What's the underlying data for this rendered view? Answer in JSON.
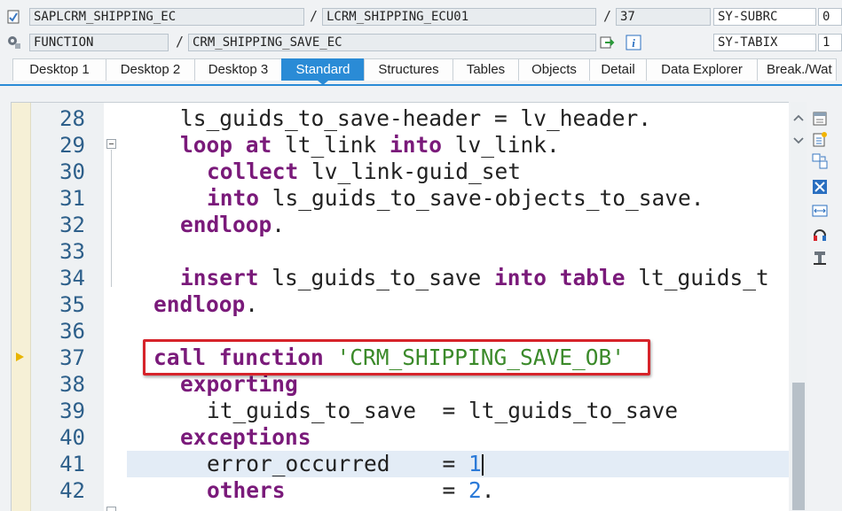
{
  "header": {
    "program": "SAPLCRM_SHIPPING_EC",
    "include": "LCRM_SHIPPING_ECU01",
    "line_no": "37",
    "sysvar1_name": "SY-SUBRC",
    "sysvar1_value": "0",
    "event_type": "FUNCTION",
    "event_name": "CRM_SHIPPING_SAVE_EC",
    "sysvar2_name": "SY-TABIX",
    "sysvar2_value": "1",
    "separator": "/"
  },
  "tabs": [
    "Desktop 1",
    "Desktop 2",
    "Desktop 3",
    "Standard",
    "Structures",
    "Tables",
    "Objects",
    "Detail",
    "Data Explorer",
    "Break./Wat"
  ],
  "active_tab": "Standard",
  "code": {
    "line_numbers": [
      "28",
      "29",
      "30",
      "31",
      "32",
      "33",
      "34",
      "35",
      "36",
      "37",
      "38",
      "39",
      "40",
      "41",
      "42"
    ],
    "current_line": "37",
    "selected_text": "call function 'CRM_SHIPPING_SAVE_OB'"
  },
  "colors": {
    "accent": "#2a8bd6",
    "keyword": "#7a1a7a",
    "string": "#3b8a2a",
    "number": "#2b7ad8",
    "highlight_border": "#d6232a"
  },
  "icons": [
    "program-icon",
    "settings-icon",
    "step-icon",
    "info-icon",
    "scroll-up-icon",
    "scroll-down-icon",
    "new-icon",
    "compare-icon",
    "fullscreen-icon",
    "width-icon",
    "watch-icon",
    "tool-icon"
  ]
}
